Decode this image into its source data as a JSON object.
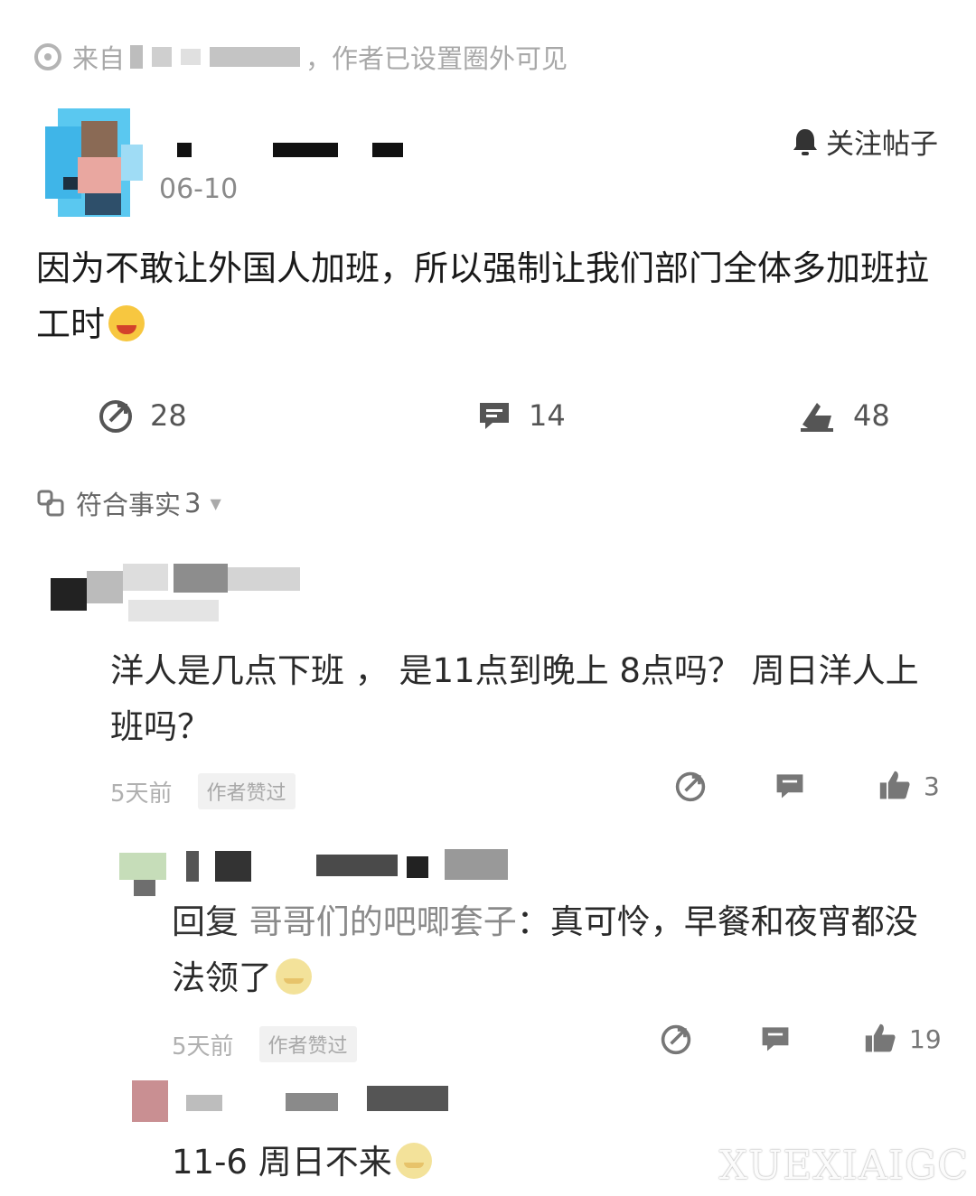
{
  "source": {
    "prefix": "来自",
    "suffix": "，作者已设置圈外可见"
  },
  "post": {
    "date": "06-10",
    "follow_label": "关注帖子",
    "text": "因为不敢让外国人加班，所以强制让我们部门全体多加班拉工时",
    "actions": {
      "forward_count": "28",
      "comment_count": "14",
      "like_count": "48"
    }
  },
  "fact_row": {
    "label": "符合事实",
    "count": "3"
  },
  "comments": [
    {
      "text": "洋人是几点下班 ， 是11点到晚上 8点吗？ 周日洋人上班吗？",
      "time": "5天前",
      "badge": "作者赞过",
      "like_count": "3"
    },
    {
      "reply_prefix": "回复",
      "reply_to": "哥哥们的吧唧套子",
      "text": "：真可怜，早餐和夜宵都没法领了",
      "time": "5天前",
      "badge": "作者赞过",
      "like_count": "19"
    },
    {
      "text": "11-6 周日不来"
    }
  ],
  "watermark": "XUEXIAIGC"
}
